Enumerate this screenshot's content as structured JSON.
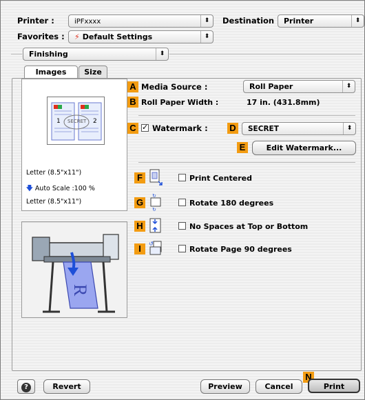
{
  "header": {
    "printer_label": "Printer :",
    "printer_value": "iPFxxxx",
    "destination_label": "Destination :",
    "destination_value": "Printer",
    "favorites_label": "Favorites :",
    "favorites_value": "Default Settings",
    "section_value": "Finishing"
  },
  "tabs": [
    {
      "label": "Images"
    },
    {
      "label": "Size"
    }
  ],
  "preview": {
    "page_line1": "Letter (8.5\"x11\")",
    "scale_line": "Auto Scale :100 %",
    "page_line2": "Letter (8.5\"x11\")",
    "page_number_1": "1",
    "page_number_2": "2",
    "watermark_text": "SECRET"
  },
  "settings": {
    "media_source_label": "Media Source :",
    "media_source_value": "Roll Paper",
    "roll_width_label": "Roll Paper Width :",
    "roll_width_value": "17 in. (431.8mm)",
    "watermark_label": "Watermark :",
    "watermark_value": "SECRET",
    "edit_watermark_label": "Edit Watermark...",
    "print_centered_label": "Print Centered",
    "rotate_180_label": "Rotate 180 degrees",
    "no_spaces_label": "No Spaces at Top or Bottom",
    "rotate_90_label": "Rotate Page 90 degrees"
  },
  "checkboxes": {
    "watermark": true,
    "print_centered": false,
    "rotate_180": false,
    "no_spaces": false,
    "rotate_90": false
  },
  "markers": {
    "a": "A",
    "b": "B",
    "c": "C",
    "d": "D",
    "e": "E",
    "f": "F",
    "g": "G",
    "h": "H",
    "i": "I",
    "n": "N"
  },
  "footer": {
    "help_glyph": "?",
    "revert_label": "Revert",
    "preview_label": "Preview",
    "cancel_label": "Cancel",
    "print_label": "Print"
  },
  "colors": {
    "marker": "#f39c12",
    "favorites_icon": "#e0301e",
    "arrow_blue": "#1e4fd8"
  }
}
